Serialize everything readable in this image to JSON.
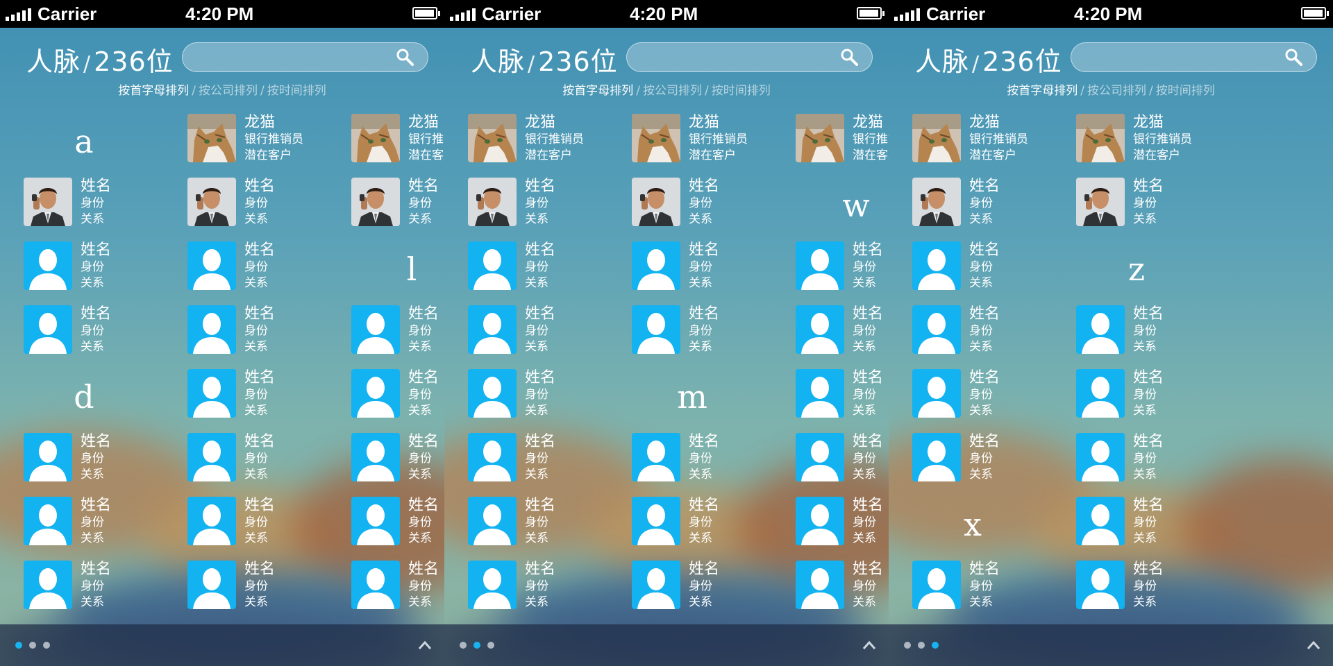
{
  "status": {
    "carrier": "Carrier",
    "time": "4:20 PM"
  },
  "header": {
    "title": "人脉",
    "separator": "/",
    "count": "236位"
  },
  "sort_options": [
    "按首字母排列",
    "按公司排列",
    "按时间排列"
  ],
  "icons": {
    "search": "search-icon",
    "chevron": "chevron-up-icon",
    "avatar_default": "default-avatar-icon"
  },
  "colors": {
    "accent": "#19b3ef",
    "avatar_bg": "#13b2f0",
    "bottom_bar": "#1e2d46"
  },
  "screens": [
    {
      "active_page": 0,
      "columns": [
        [
          {
            "type": "letter",
            "text": "a"
          },
          {
            "type": "contact",
            "avatar": "man",
            "name": "姓名",
            "role": "身份",
            "relation": "关系"
          },
          {
            "type": "contact",
            "avatar": "default",
            "name": "姓名",
            "role": "身份",
            "relation": "关系"
          },
          {
            "type": "contact",
            "avatar": "default",
            "name": "姓名",
            "role": "身份",
            "relation": "关系"
          },
          {
            "type": "letter",
            "text": "d"
          },
          {
            "type": "contact",
            "avatar": "default",
            "name": "姓名",
            "role": "身份",
            "relation": "关系"
          },
          {
            "type": "contact",
            "avatar": "default",
            "name": "姓名",
            "role": "身份",
            "relation": "关系"
          },
          {
            "type": "contact",
            "avatar": "default",
            "name": "姓名",
            "role": "身份",
            "relation": "关系"
          }
        ],
        [
          {
            "type": "contact",
            "avatar": "cat",
            "name": "龙猫",
            "role": "银行推销员",
            "relation": "潜在客户"
          },
          {
            "type": "contact",
            "avatar": "man",
            "name": "姓名",
            "role": "身份",
            "relation": "关系"
          },
          {
            "type": "contact",
            "avatar": "default",
            "name": "姓名",
            "role": "身份",
            "relation": "关系"
          },
          {
            "type": "contact",
            "avatar": "default",
            "name": "姓名",
            "role": "身份",
            "relation": "关系"
          },
          {
            "type": "contact",
            "avatar": "default",
            "name": "姓名",
            "role": "身份",
            "relation": "关系"
          },
          {
            "type": "contact",
            "avatar": "default",
            "name": "姓名",
            "role": "身份",
            "relation": "关系"
          },
          {
            "type": "contact",
            "avatar": "default",
            "name": "姓名",
            "role": "身份",
            "relation": "关系"
          },
          {
            "type": "contact",
            "avatar": "default",
            "name": "姓名",
            "role": "身份",
            "relation": "关系"
          }
        ],
        [
          {
            "type": "contact",
            "avatar": "cat",
            "name": "龙猫",
            "role": "银行推销员",
            "relation": "潜在客户"
          },
          {
            "type": "contact",
            "avatar": "man",
            "name": "姓名",
            "role": "身份",
            "relation": "关系"
          },
          {
            "type": "letter",
            "text": "l"
          },
          {
            "type": "contact",
            "avatar": "default",
            "name": "姓名",
            "role": "身份",
            "relation": "关系"
          },
          {
            "type": "contact",
            "avatar": "default",
            "name": "姓名",
            "role": "身份",
            "relation": "关系"
          },
          {
            "type": "contact",
            "avatar": "default",
            "name": "姓名",
            "role": "身份",
            "relation": "关系"
          },
          {
            "type": "contact",
            "avatar": "default",
            "name": "姓名",
            "role": "身份",
            "relation": "关系"
          },
          {
            "type": "contact",
            "avatar": "default",
            "name": "姓名",
            "role": "身份",
            "relation": "关系"
          }
        ]
      ]
    },
    {
      "active_page": 1,
      "columns": [
        [
          {
            "type": "contact",
            "avatar": "cat",
            "name": "龙猫",
            "role": "银行推销员",
            "relation": "潜在客户"
          },
          {
            "type": "contact",
            "avatar": "man",
            "name": "姓名",
            "role": "身份",
            "relation": "关系"
          },
          {
            "type": "contact",
            "avatar": "default",
            "name": "姓名",
            "role": "身份",
            "relation": "关系"
          },
          {
            "type": "contact",
            "avatar": "default",
            "name": "姓名",
            "role": "身份",
            "relation": "关系"
          },
          {
            "type": "contact",
            "avatar": "default",
            "name": "姓名",
            "role": "身份",
            "relation": "关系"
          },
          {
            "type": "contact",
            "avatar": "default",
            "name": "姓名",
            "role": "身份",
            "relation": "关系"
          },
          {
            "type": "contact",
            "avatar": "default",
            "name": "姓名",
            "role": "身份",
            "relation": "关系"
          },
          {
            "type": "contact",
            "avatar": "default",
            "name": "姓名",
            "role": "身份",
            "relation": "关系"
          }
        ],
        [
          {
            "type": "contact",
            "avatar": "cat",
            "name": "龙猫",
            "role": "银行推销员",
            "relation": "潜在客户"
          },
          {
            "type": "contact",
            "avatar": "man",
            "name": "姓名",
            "role": "身份",
            "relation": "关系"
          },
          {
            "type": "contact",
            "avatar": "default",
            "name": "姓名",
            "role": "身份",
            "relation": "关系"
          },
          {
            "type": "contact",
            "avatar": "default",
            "name": "姓名",
            "role": "身份",
            "relation": "关系"
          },
          {
            "type": "letter",
            "text": "m"
          },
          {
            "type": "contact",
            "avatar": "default",
            "name": "姓名",
            "role": "身份",
            "relation": "关系"
          },
          {
            "type": "contact",
            "avatar": "default",
            "name": "姓名",
            "role": "身份",
            "relation": "关系"
          },
          {
            "type": "contact",
            "avatar": "default",
            "name": "姓名",
            "role": "身份",
            "relation": "关系"
          }
        ],
        [
          {
            "type": "contact",
            "avatar": "cat",
            "name": "龙猫",
            "role": "银行推销员",
            "relation": "潜在客户"
          },
          {
            "type": "letter",
            "text": "w"
          },
          {
            "type": "contact",
            "avatar": "default",
            "name": "姓名",
            "role": "身份",
            "relation": "关系"
          },
          {
            "type": "contact",
            "avatar": "default",
            "name": "姓名",
            "role": "身份",
            "relation": "关系"
          },
          {
            "type": "contact",
            "avatar": "default",
            "name": "姓名",
            "role": "身份",
            "relation": "关系"
          },
          {
            "type": "contact",
            "avatar": "default",
            "name": "姓名",
            "role": "身份",
            "relation": "关系"
          },
          {
            "type": "contact",
            "avatar": "default",
            "name": "姓名",
            "role": "身份",
            "relation": "关系"
          },
          {
            "type": "contact",
            "avatar": "default",
            "name": "姓名",
            "role": "身份",
            "relation": "关系"
          }
        ]
      ]
    },
    {
      "active_page": 2,
      "columns": [
        [
          {
            "type": "contact",
            "avatar": "cat",
            "name": "龙猫",
            "role": "银行推销员",
            "relation": "潜在客户"
          },
          {
            "type": "contact",
            "avatar": "man",
            "name": "姓名",
            "role": "身份",
            "relation": "关系"
          },
          {
            "type": "contact",
            "avatar": "default",
            "name": "姓名",
            "role": "身份",
            "relation": "关系"
          },
          {
            "type": "contact",
            "avatar": "default",
            "name": "姓名",
            "role": "身份",
            "relation": "关系"
          },
          {
            "type": "contact",
            "avatar": "default",
            "name": "姓名",
            "role": "身份",
            "relation": "关系"
          },
          {
            "type": "contact",
            "avatar": "default",
            "name": "姓名",
            "role": "身份",
            "relation": "关系"
          },
          {
            "type": "letter",
            "text": "x"
          },
          {
            "type": "contact",
            "avatar": "default",
            "name": "姓名",
            "role": "身份",
            "relation": "关系"
          }
        ],
        [
          {
            "type": "contact",
            "avatar": "cat",
            "name": "龙猫",
            "role": "银行推销员",
            "relation": "潜在客户"
          },
          {
            "type": "contact",
            "avatar": "man",
            "name": "姓名",
            "role": "身份",
            "relation": "关系"
          },
          {
            "type": "letter",
            "text": "z"
          },
          {
            "type": "contact",
            "avatar": "default",
            "name": "姓名",
            "role": "身份",
            "relation": "关系"
          },
          {
            "type": "contact",
            "avatar": "default",
            "name": "姓名",
            "role": "身份",
            "relation": "关系"
          },
          {
            "type": "contact",
            "avatar": "default",
            "name": "姓名",
            "role": "身份",
            "relation": "关系"
          },
          {
            "type": "contact",
            "avatar": "default",
            "name": "姓名",
            "role": "身份",
            "relation": "关系"
          },
          {
            "type": "contact",
            "avatar": "default",
            "name": "姓名",
            "role": "身份",
            "relation": "关系"
          }
        ]
      ]
    }
  ]
}
